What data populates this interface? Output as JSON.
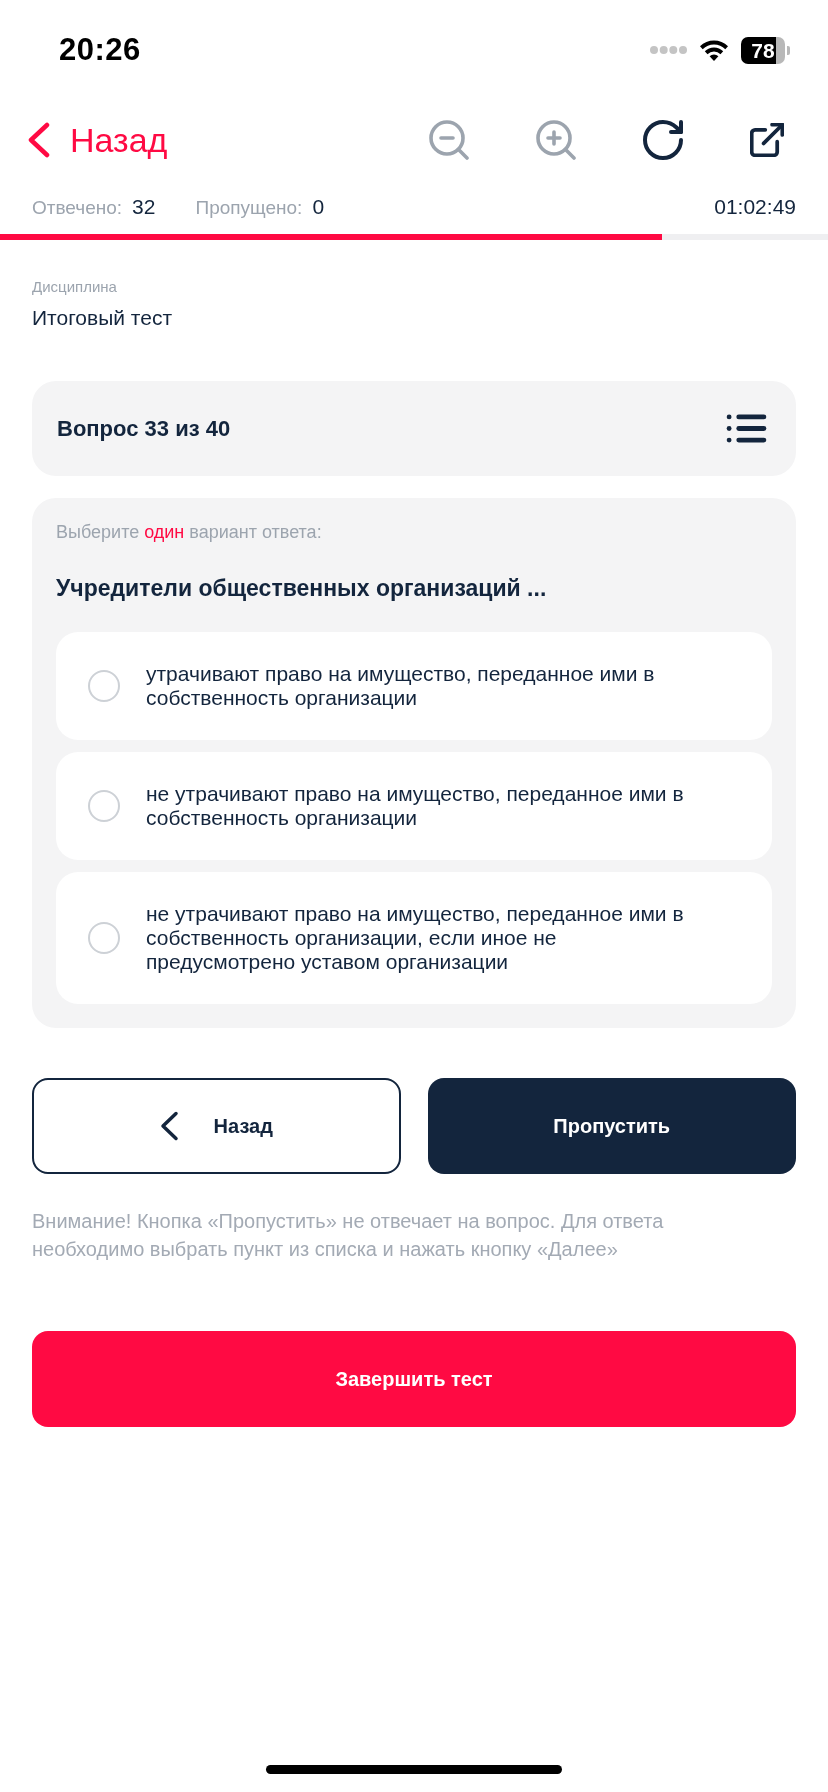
{
  "status_bar": {
    "time": "20:26",
    "battery": "78"
  },
  "header": {
    "back_label": "Назад",
    "actions": [
      {
        "kind": "zoom_out",
        "disabled": true
      },
      {
        "kind": "zoom_in",
        "disabled": true
      },
      {
        "kind": "refresh",
        "disabled": false
      },
      {
        "kind": "open_external",
        "disabled": false
      }
    ]
  },
  "stats": {
    "items": [
      {
        "label": "Отвечено:",
        "value": "32"
      },
      {
        "label": "Пропущено:",
        "value": "0"
      }
    ],
    "timer": "01:02:49"
  },
  "progress": {
    "level": 0.8
  },
  "discipline": {
    "label": "Дисциплина",
    "value": "Итоговый тест"
  },
  "question_header": {
    "title": "Вопрос 33 из 40"
  },
  "question": {
    "instruction": {
      "before": "Выберите ",
      "emphasis": "один",
      "after": " вариант ответа:"
    },
    "text": "Учредители общественных организаций ...",
    "options": [
      {
        "text": "утрачивают право на имущество, переданное ими в собственность организации",
        "selected": false
      },
      {
        "text": "не утрачивают право на имущество, переданное ими в собственность организации",
        "selected": false
      },
      {
        "text": "не утрачивают право на имущество, переданное ими в собственность организации, если иное не предусмотрено уставом организации",
        "selected": false
      }
    ]
  },
  "nav_buttons": {
    "back": "Назад",
    "skip": "Пропустить"
  },
  "notice": "Внимание! Кнопка «Пропустить» не отвечает на вопрос. Для ответа необходимо выбрать пункт из списка и нажать кнопку «Далее»",
  "finish_button": "Завершить тест"
}
